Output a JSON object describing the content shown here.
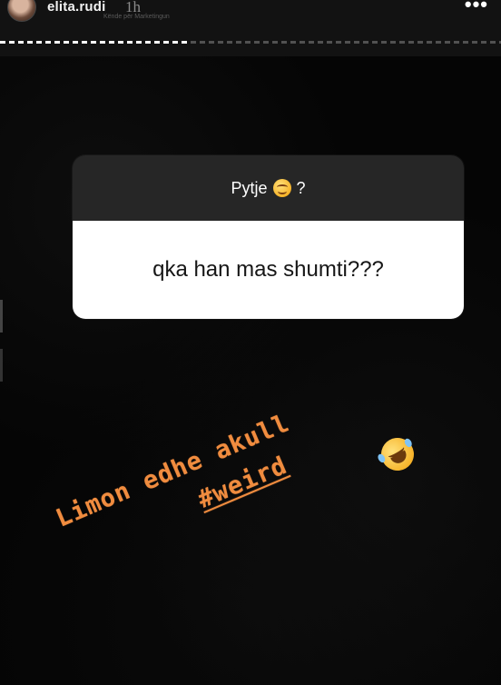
{
  "header": {
    "username": "elita.rudi",
    "timestamp": "1h",
    "subtitle": "Kënde për Marketingun",
    "more_icon": "more-horizontal-icon",
    "progress": 0.38
  },
  "question_sticker": {
    "title": "Pytje",
    "title_suffix": "?",
    "emoji": "smiling-face-icon",
    "answer": "qka han mas shumti???"
  },
  "caption": {
    "line1": "Limon edhe akull",
    "line2": "#weird",
    "color": "#f08c3f",
    "emoji": "rolling-on-floor-laughing-icon"
  },
  "colors": {
    "background": "#050505",
    "card_header": "#262626",
    "card_body": "#ffffff",
    "accent": "#f08c3f"
  }
}
